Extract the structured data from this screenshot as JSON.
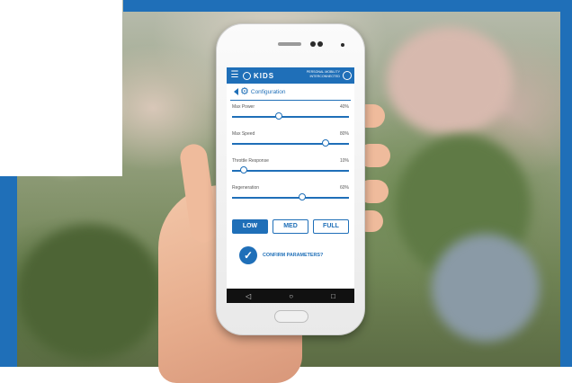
{
  "app": {
    "brand": "KIDS",
    "tagline_line1": "PERSONAL MOBILITY",
    "tagline_line2": "INTERCONNECTED"
  },
  "header": {
    "title": "Configuration"
  },
  "sliders": [
    {
      "label": "Max Power",
      "value": "40%",
      "level": 0.4
    },
    {
      "label": "Max Speed",
      "value": "80%",
      "level": 0.8
    },
    {
      "label": "Throttle Response",
      "value": "10%",
      "level": 0.1
    },
    {
      "label": "Regeneration",
      "value": "60%",
      "level": 0.6
    }
  ],
  "presets": [
    {
      "label": "LOW",
      "active": true
    },
    {
      "label": "MED",
      "active": false
    },
    {
      "label": "FULL",
      "active": false
    }
  ],
  "confirm": {
    "label": "CONFIRM PARAMETERS?"
  },
  "navbar": {
    "back": "◁",
    "home": "○",
    "recent": "□"
  },
  "icons": {
    "menu": "menu-icon",
    "logo": "logo-icon",
    "power": "power-icon",
    "back": "back-icon",
    "gear": "gear-icon",
    "check": "check-icon"
  },
  "colors": {
    "accent": "#1f6fb8",
    "frame": "#1f6fb8",
    "navbar": "#111111"
  }
}
